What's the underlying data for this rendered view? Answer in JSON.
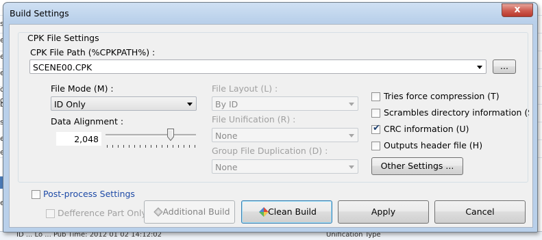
{
  "background": {
    "footer_text": "ID ... Lo ... Pub Time: 2012 01 02 14:12:02",
    "footer_right": "Unification Type",
    "edge_chars": [
      "s",
      "e",
      "e",
      "e",
      "o",
      "o",
      "b",
      "s",
      "e",
      "e",
      "e"
    ]
  },
  "dialog": {
    "title": "Build Settings",
    "close_glyph": "x"
  },
  "cpk": {
    "group_label": "CPK File Settings",
    "path_label": "CPK File Path (%CPKPATH%) :",
    "path_value": "SCENE00.CPK",
    "browse_label": "..."
  },
  "left": {
    "file_mode_label": "File Mode (M) :",
    "file_mode_value": "ID Only",
    "data_alignment_label": "Data Alignment :",
    "data_alignment_value": "2,048",
    "slider_fraction": 0.72
  },
  "middle": {
    "file_layout_label": "File Layout (L) :",
    "file_layout_value": "By ID",
    "file_unification_label": "File Unification (R) :",
    "file_unification_value": "None",
    "group_dup_label": "Group File Duplication (D) :",
    "group_dup_value": "None"
  },
  "options": [
    {
      "label": "Tries force compression (T)",
      "checked": false
    },
    {
      "label": "Scrambles directory information (S",
      "checked": false
    },
    {
      "label": "CRC information (U)",
      "checked": true
    },
    {
      "label": "Outputs header file (H)",
      "checked": false
    }
  ],
  "other_settings_label": "Other Settings ...",
  "postprocess": {
    "label": "Post-process Settings",
    "difference_label": "Defference Part Only"
  },
  "buttons": {
    "additional_build": "Additional Build",
    "clean_build": "Clean Build",
    "apply": "Apply",
    "cancel": "Cancel"
  }
}
